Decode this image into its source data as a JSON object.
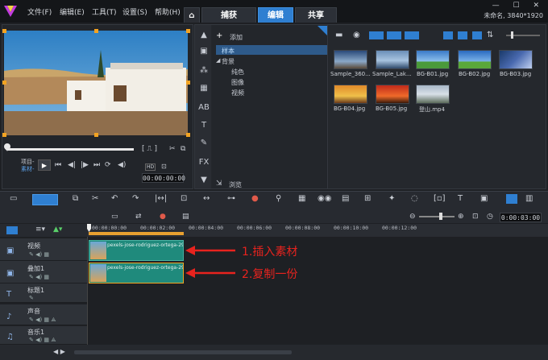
{
  "app": {
    "status": "未命名, 3840*1920",
    "window_controls": "— ☐ ✕"
  },
  "menu": [
    "文件(F)",
    "编辑(E)",
    "工具(T)",
    "设置(S)",
    "帮助(H)"
  ],
  "tabs": [
    "捕获",
    "编辑",
    "共享"
  ],
  "player": {
    "project_label": "项目-",
    "clip_label": "素材-",
    "timecode": "00:00:00:00",
    "hd_badge": "HD",
    "preview_icon": "⊡"
  },
  "library": {
    "add_label": "添加",
    "tree": [
      "样本",
      "背景",
      "纯色",
      "图像",
      "视频"
    ],
    "browse_label": "浏览",
    "items": [
      {
        "name": "Sample_360..."
      },
      {
        "name": "Sample_Lak..."
      },
      {
        "name": "BG-B01.jpg"
      },
      {
        "name": "BG-B02.jpg"
      },
      {
        "name": "BG-B03.jpg"
      },
      {
        "name": "BG-B04.jpg"
      },
      {
        "name": "BG-B05.jpg"
      },
      {
        "name": "登山.mp4"
      }
    ]
  },
  "timeline": {
    "timecode": "0:00:03:00",
    "ruler": [
      "00:00:00:00",
      "00:00:02:00",
      "00:00:04:00",
      "00:00:06:00",
      "00:00:08:00",
      "00:00:10:00",
      "00:00:12:00"
    ],
    "tracks": [
      {
        "name": "视频",
        "icon": "video-track-icon"
      },
      {
        "name": "叠加1",
        "icon": "overlay-track-icon"
      },
      {
        "name": "标题1",
        "icon": "title-track-icon"
      },
      {
        "name": "声音",
        "icon": "voice-track-icon"
      },
      {
        "name": "音乐1",
        "icon": "music-track-icon"
      }
    ],
    "clips": [
      {
        "label": "pexels-jose-rodriguez-ortega-29"
      },
      {
        "label": "pexels-jose-rodriguez-ortega-29"
      }
    ],
    "annotations": [
      "1.插入素材",
      "2.复制一份"
    ]
  }
}
